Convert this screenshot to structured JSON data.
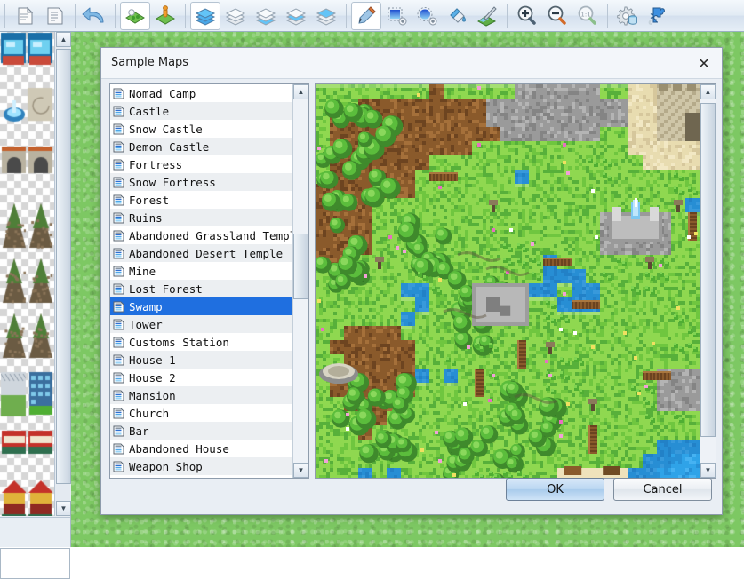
{
  "toolbar": {
    "groups": [
      {
        "items": [
          {
            "name": "new-map-icon",
            "label": "New Map",
            "active": false
          },
          {
            "name": "document-properties-icon",
            "label": "Map Properties",
            "active": false
          }
        ]
      },
      {
        "items": [
          {
            "name": "undo-icon",
            "label": "Undo",
            "active": false
          }
        ]
      },
      {
        "items": [
          {
            "name": "terrain-layer-icon",
            "label": "Terrain Mode",
            "active": true
          },
          {
            "name": "event-layer-icon",
            "label": "Event Mode",
            "active": false
          }
        ]
      },
      {
        "items": [
          {
            "name": "all-layers-icon",
            "label": "All Layers",
            "active": true
          },
          {
            "name": "layer-1-icon",
            "label": "Layer 1",
            "active": false
          },
          {
            "name": "layer-2-icon",
            "label": "Layer 2",
            "active": false
          },
          {
            "name": "layer-3-icon",
            "label": "Layer 3",
            "active": false
          },
          {
            "name": "layer-4-icon",
            "label": "Layer 4",
            "active": false
          }
        ]
      },
      {
        "items": [
          {
            "name": "pencil-icon",
            "label": "Pencil",
            "active": true
          },
          {
            "name": "rectangle-select-icon",
            "label": "Rectangle",
            "active": false
          },
          {
            "name": "ellipse-select-icon",
            "label": "Ellipse",
            "active": false
          },
          {
            "name": "fill-bucket-icon",
            "label": "Fill",
            "active": false
          },
          {
            "name": "eyedropper-icon",
            "label": "Pick Tile",
            "active": false
          }
        ]
      },
      {
        "items": [
          {
            "name": "zoom-in-icon",
            "label": "Zoom In",
            "active": false
          },
          {
            "name": "zoom-out-icon",
            "label": "Zoom Out",
            "active": false
          },
          {
            "name": "zoom-actual-icon",
            "label": "Actual Size",
            "active": false
          }
        ]
      },
      {
        "items": [
          {
            "name": "database-settings-icon",
            "label": "Database",
            "active": false
          },
          {
            "name": "plugin-icon",
            "label": "Plugin Manager",
            "active": false
          }
        ]
      }
    ]
  },
  "palette": {
    "name": "tile-palette",
    "scroll_up_glyph": "▲",
    "scroll_down_glyph": "▼"
  },
  "dialog": {
    "title": "Sample Maps",
    "close_glyph": "✕",
    "ok_label": "OK",
    "cancel_label": "Cancel",
    "list": {
      "selected_index": 12,
      "items": [
        "Nomad Camp",
        "Castle",
        "Snow Castle",
        "Demon Castle",
        "Fortress",
        "Snow Fortress",
        "Forest",
        "Ruins",
        "Abandoned Grassland Temple",
        "Abandoned Desert Temple",
        "Mine",
        "Lost Forest",
        "Swamp",
        "Tower",
        "Customs Station",
        "House 1",
        "House 2",
        "Mansion",
        "Church",
        "Bar",
        "Abandoned House",
        "Weapon Shop"
      ],
      "scroll_up_glyph": "▲",
      "scroll_down_glyph": "▼",
      "thumb_top_pct": 37,
      "thumb_height_pct": 18
    },
    "preview": {
      "name": "map-preview",
      "scroll_up_glyph": "▲",
      "scroll_down_glyph": "▼",
      "thumb_top_pct": 1,
      "thumb_height_pct": 92
    }
  },
  "colors": {
    "accent": "#1f6fe0",
    "canvas_green": "#7dc863",
    "dialog_face": "#e9eef4",
    "water": "#2fa3e8",
    "grass_light": "#8fd850",
    "grass_dark": "#57b03a",
    "dirt": "#8a5a2b",
    "stone": "#9a9a9a",
    "sand": "#e8dcb0"
  }
}
